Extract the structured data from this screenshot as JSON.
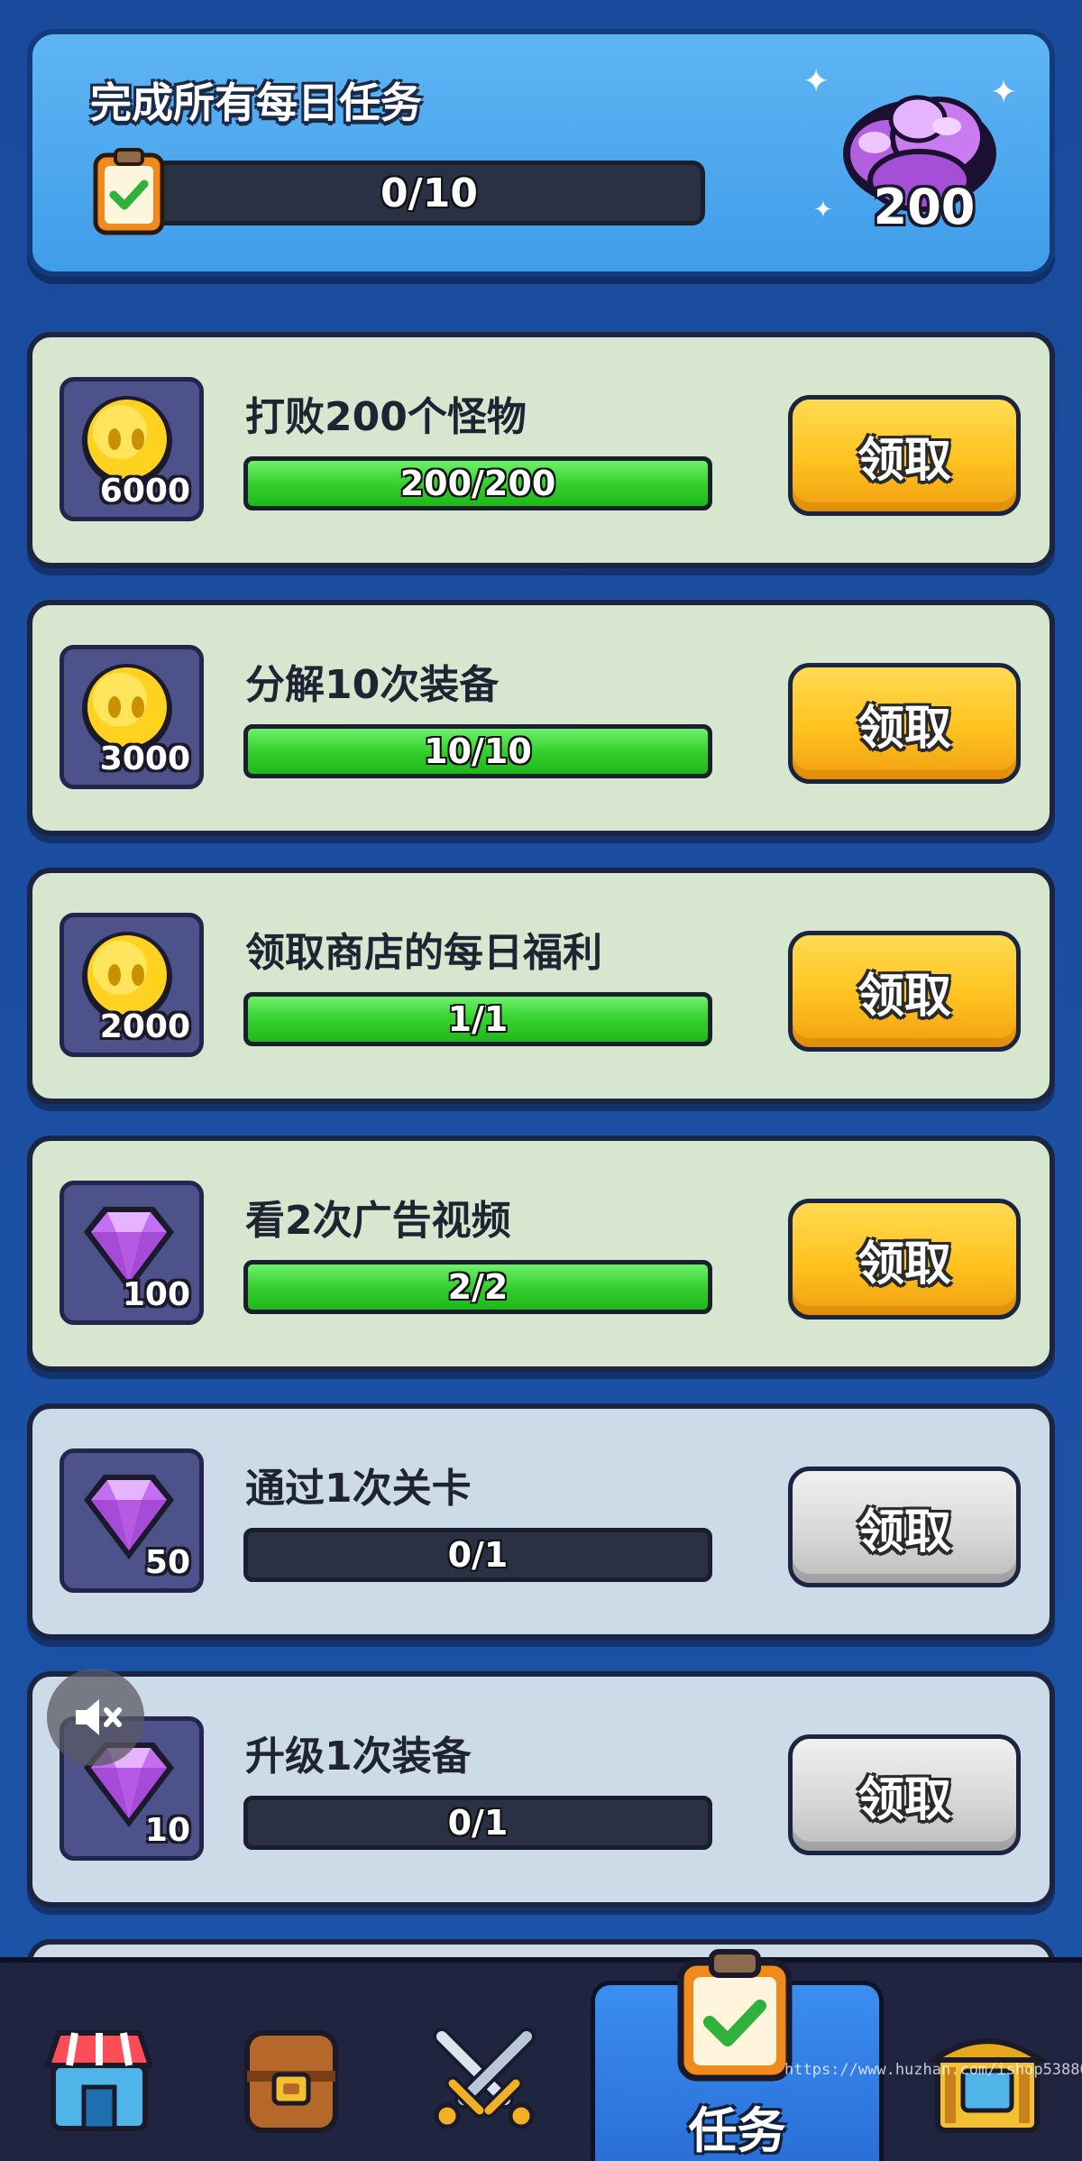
{
  "header": {
    "title": "完成所有每日任务",
    "progress_text": "0/10",
    "progress": 0,
    "reward_amount": "200",
    "reward_icon": "gem-pile-icon"
  },
  "tasks": [
    {
      "title": "打败200个怪物",
      "reward_amount": "6000",
      "reward_icon": "gold-coin-icon",
      "progress_text": "200/200",
      "progress": 1.0,
      "button_label": "领取",
      "state": "claimable"
    },
    {
      "title": "分解10次装备",
      "reward_amount": "3000",
      "reward_icon": "gold-coin-icon",
      "progress_text": "10/10",
      "progress": 1.0,
      "button_label": "领取",
      "state": "claimable"
    },
    {
      "title": "领取商店的每日福利",
      "reward_amount": "2000",
      "reward_icon": "gold-coin-icon",
      "progress_text": "1/1",
      "progress": 1.0,
      "button_label": "领取",
      "state": "claimable"
    },
    {
      "title": "看2次广告视频",
      "reward_amount": "100",
      "reward_icon": "purple-gem-icon",
      "progress_text": "2/2",
      "progress": 1.0,
      "button_label": "领取",
      "state": "claimable"
    },
    {
      "title": "通过1次关卡",
      "reward_amount": "50",
      "reward_icon": "purple-gem-icon",
      "progress_text": "0/1",
      "progress": 0,
      "button_label": "领取",
      "state": "locked"
    },
    {
      "title": "升级1次装备",
      "reward_amount": "10",
      "reward_icon": "purple-gem-icon",
      "progress_text": "0/1",
      "progress": 0,
      "button_label": "领取",
      "state": "locked"
    }
  ],
  "bottom_nav": {
    "items": [
      {
        "icon": "shop-icon"
      },
      {
        "icon": "backpack-icon"
      },
      {
        "icon": "battle-swords-icon"
      },
      {
        "icon": "tasks-clipboard-icon",
        "label": "任务",
        "active": true
      },
      {
        "icon": "treasure-hall-icon"
      }
    ],
    "active_label": "任务"
  },
  "overlay": {
    "mute_icon": "muted-speaker-icon",
    "watermark": "https://www.huzhan.com/ishop53880"
  },
  "colors": {
    "background": "#1d4fa0",
    "header_card": "#4aa7ee",
    "done_card": "#d7e6cf",
    "todo_card": "#cddbe8",
    "progress_green": "#35d12f",
    "button_yellow": "#ffc21f",
    "button_gray": "#d8d8d8",
    "nav_active": "#2f7ae4"
  }
}
